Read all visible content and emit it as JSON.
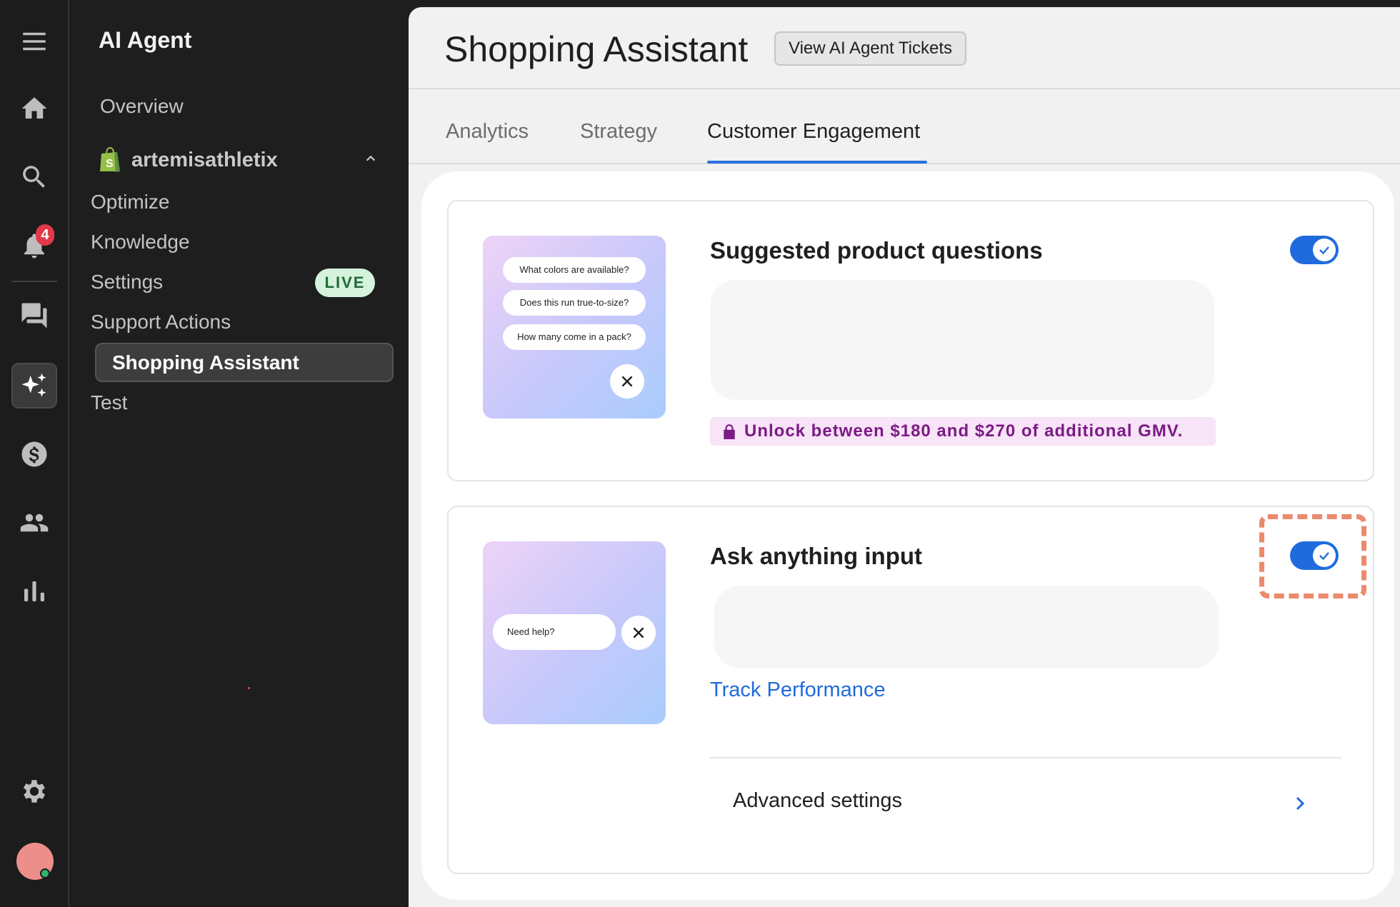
{
  "rail": {
    "notification_count": "4",
    "items": [
      "menu-icon",
      "home-icon",
      "search-icon",
      "bell-icon",
      "chat-icon",
      "sparkle-icon",
      "dollar-icon",
      "users-icon",
      "chart-icon",
      "gear-icon"
    ]
  },
  "sidebar": {
    "title": "AI Agent",
    "overview": "Overview",
    "store_name": "artemisathletix",
    "items": [
      {
        "label": "Optimize"
      },
      {
        "label": "Knowledge"
      },
      {
        "label": "Settings",
        "badge": "LIVE"
      },
      {
        "label": "Support Actions"
      },
      {
        "label": "Shopping Assistant",
        "active": true
      },
      {
        "label": "Test"
      }
    ]
  },
  "header": {
    "title": "Shopping Assistant",
    "view_tickets_label": "View AI Agent Tickets"
  },
  "tabs": [
    {
      "label": "Analytics"
    },
    {
      "label": "Strategy"
    },
    {
      "label": "Customer Engagement",
      "active": true
    }
  ],
  "cards": {
    "suggested": {
      "title": "Suggested product questions",
      "enabled": true,
      "preview_questions": [
        "What colors are available?",
        "Does this run true-to-size?",
        "How many come in a pack?"
      ],
      "gmv_text": "Unlock between $180 and $270 of additional GMV."
    },
    "ask_anything": {
      "title": "Ask anything input",
      "enabled": true,
      "preview_input": "Need help?",
      "track_link": "Track Performance",
      "advanced_label": "Advanced settings"
    }
  },
  "colors": {
    "accent": "#1f6bde",
    "gmv_text": "#7c1a86",
    "gmv_bg": "#f7e4f6",
    "live_bg": "#d5f2dc",
    "highlight": "#ec8a6c"
  }
}
